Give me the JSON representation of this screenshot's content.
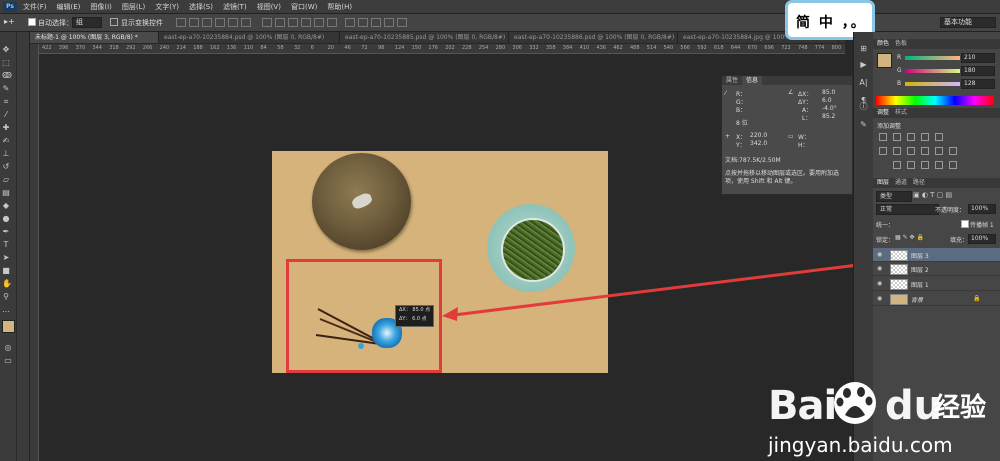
{
  "app": {
    "logo": "Ps"
  },
  "menu": [
    "文件(F)",
    "编辑(E)",
    "图像(I)",
    "图层(L)",
    "文字(Y)",
    "选择(S)",
    "滤镜(T)",
    "视图(V)",
    "窗口(W)",
    "帮助(H)"
  ],
  "options_bar": {
    "auto_select_label": "自动选择：",
    "auto_select_value": "组",
    "show_transform_label": "显示变换控件",
    "workspace": "基本功能"
  },
  "tabs": [
    {
      "label": "未标题-1 @ 100% (图层 3, RGB/8) *",
      "active": true
    },
    {
      "label": "east-ep-a70-10235884.psd @ 100% (图层 0, RGB/8#)",
      "active": false
    },
    {
      "label": "east-ep-a70-10235885.psd @ 100% (图层 0, RGB/8#)",
      "active": false
    },
    {
      "label": "east-ep-a70-10235886.psd @ 100% (图层 0, RGB/8#)",
      "active": false
    },
    {
      "label": "east-ep-a70-10235884.jpg @ 100%(RGB/8#)",
      "active": false
    }
  ],
  "ruler_ticks": [
    "422",
    "396",
    "370",
    "344",
    "318",
    "292",
    "266",
    "240",
    "214",
    "188",
    "162",
    "136",
    "110",
    "84",
    "58",
    "32",
    "6",
    "20",
    "46",
    "72",
    "98",
    "124",
    "150",
    "176",
    "202",
    "228",
    "254",
    "280",
    "306",
    "332",
    "358",
    "384",
    "410",
    "436",
    "462",
    "488",
    "514",
    "540",
    "566",
    "592",
    "618",
    "644",
    "670",
    "696",
    "722",
    "748",
    "774",
    "800"
  ],
  "callout": {
    "text": "简 中 ，。"
  },
  "measure_tooltip": {
    "line1": "ΔX： 85.0 点",
    "line2": "ΔY： 6.0 点"
  },
  "info_panel": {
    "tabs": [
      "属性",
      "信息"
    ],
    "r": "R：",
    "g": "G：",
    "b": "B：",
    "bit_depth": "8 位",
    "dx_label": "ΔX：",
    "dx": "85.0",
    "dy_label": "ΔY：",
    "dy": "6.0",
    "a_label": "A：",
    "a": "-4.0°",
    "l_label": "L：",
    "l": "85.2",
    "x_label": "X：",
    "x": "220.0",
    "y_label": "Y：",
    "y": "342.0",
    "w_label": "W：",
    "h_label": "H：",
    "doc_size": "文档:787.5K/2.50M",
    "hint": "点按并拖移以移动图层或选区。要用附加选项，使用 Shift 和 Alt 键。"
  },
  "color_panel": {
    "tabs": [
      "颜色",
      "色板"
    ],
    "r_label": "R",
    "g_label": "G",
    "b_label": "B",
    "r": "210",
    "g": "180",
    "b": "128",
    "swatch_color": "#d2b480"
  },
  "adjust_panel": {
    "tabs": [
      "调整",
      "样式"
    ],
    "title": "添加调整"
  },
  "layers_panel": {
    "tabs": [
      "图层",
      "通道",
      "路径"
    ],
    "kind_filter": "类型",
    "blend_mode": "正常",
    "opacity_label": "不透明度：",
    "opacity": "100%",
    "lock_label": "锁定：",
    "fill_label": "填充：",
    "fill": "100%",
    "unify_label": "统一：",
    "propagate_label": "传播帧 1",
    "layers": [
      {
        "name": "图层 3",
        "selected": true
      },
      {
        "name": "图层 2",
        "selected": false
      },
      {
        "name": "图层 1",
        "selected": false
      },
      {
        "name": "背景",
        "selected": false
      }
    ]
  },
  "watermark": {
    "bai": "Bai",
    "du": "du",
    "jingyan": "经验",
    "url": "jingyan.baidu.com"
  }
}
